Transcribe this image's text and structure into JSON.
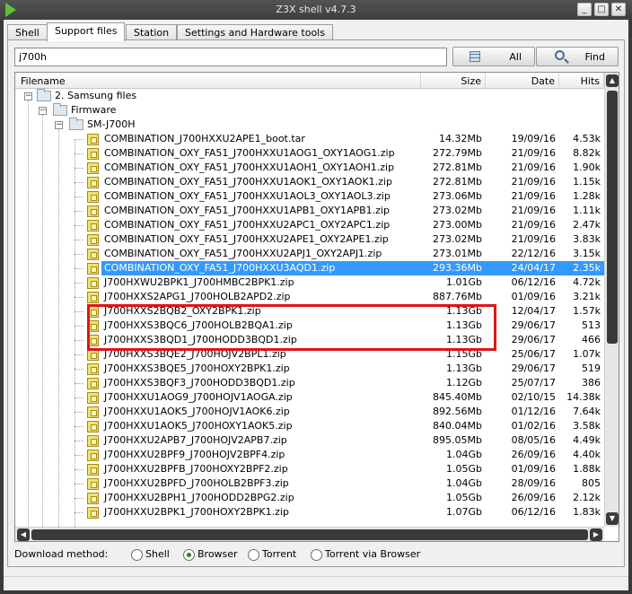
{
  "window": {
    "title": "Z3X shell v4.7.3"
  },
  "tabs": [
    {
      "label": "Shell"
    },
    {
      "label": "Support files"
    },
    {
      "label": "Station"
    },
    {
      "label": "Settings and Hardware tools"
    }
  ],
  "search": {
    "value": "j700h"
  },
  "buttons": {
    "all": "All",
    "find": "Find"
  },
  "columns": {
    "filename": "Filename",
    "size": "Size",
    "date": "Date",
    "hits": "Hits"
  },
  "tree": {
    "root": "2. Samsung files",
    "firmware": "Firmware",
    "model": "SM-J700H"
  },
  "files": [
    {
      "name": "COMBINATION_J700HXXU2APE1_boot.tar",
      "size": "14.32Mb",
      "date": "19/09/16",
      "hits": "4.53k"
    },
    {
      "name": "COMBINATION_OXY_FA51_J700HXXU1AOG1_OXY1AOG1.zip",
      "size": "272.79Mb",
      "date": "21/09/16",
      "hits": "8.82k"
    },
    {
      "name": "COMBINATION_OXY_FA51_J700HXXU1AOH1_OXY1AOH1.zip",
      "size": "272.81Mb",
      "date": "21/09/16",
      "hits": "1.90k"
    },
    {
      "name": "COMBINATION_OXY_FA51_J700HXXU1AOK1_OXY1AOK1.zip",
      "size": "272.81Mb",
      "date": "21/09/16",
      "hits": "1.15k"
    },
    {
      "name": "COMBINATION_OXY_FA51_J700HXXU1AOL3_OXY1AOL3.zip",
      "size": "273.06Mb",
      "date": "21/09/16",
      "hits": "1.28k"
    },
    {
      "name": "COMBINATION_OXY_FA51_J700HXXU1APB1_OXY1APB1.zip",
      "size": "273.02Mb",
      "date": "21/09/16",
      "hits": "1.11k"
    },
    {
      "name": "COMBINATION_OXY_FA51_J700HXXU2APC1_OXY2APC1.zip",
      "size": "273.00Mb",
      "date": "21/09/16",
      "hits": "2.47k"
    },
    {
      "name": "COMBINATION_OXY_FA51_J700HXXU2APE1_OXY2APE1.zip",
      "size": "273.02Mb",
      "date": "21/09/16",
      "hits": "3.83k"
    },
    {
      "name": "COMBINATION_OXY_FA51_J700HXXU2APJ1_OXY2APJ1.zip",
      "size": "273.01Mb",
      "date": "22/12/16",
      "hits": "3.15k"
    },
    {
      "name": "COMBINATION_OXY_FA51_J700HXXU3AQD1.zip",
      "size": "293.36Mb",
      "date": "24/04/17",
      "hits": "2.35k"
    },
    {
      "name": "J700HXWU2BPK1_J700HMBC2BPK1.zip",
      "size": "1.01Gb",
      "date": "06/12/16",
      "hits": "4.72k"
    },
    {
      "name": "J700HXXS2APG1_J700HOLB2APD2.zip",
      "size": "887.76Mb",
      "date": "01/09/16",
      "hits": "3.21k"
    },
    {
      "name": "J700HXXS2BQB2_OXY2BPK1.zip",
      "size": "1.13Gb",
      "date": "12/04/17",
      "hits": "1.57k"
    },
    {
      "name": "J700HXXS3BQC6_J700HOLB2BQA1.zip",
      "size": "1.13Gb",
      "date": "29/06/17",
      "hits": "513"
    },
    {
      "name": "J700HXXS3BQD1_J700HODD3BQD1.zip",
      "size": "1.13Gb",
      "date": "29/06/17",
      "hits": "466"
    },
    {
      "name": "J700HXXS3BQE2_J700HOJV2BPL1.zip",
      "size": "1.15Gb",
      "date": "25/06/17",
      "hits": "1.07k"
    },
    {
      "name": "J700HXXS3BQE5_J700HOXY2BPK1.zip",
      "size": "1.13Gb",
      "date": "29/06/17",
      "hits": "519"
    },
    {
      "name": "J700HXXS3BQF3_J700HODD3BQD1.zip",
      "size": "1.12Gb",
      "date": "25/07/17",
      "hits": "386"
    },
    {
      "name": "J700HXXU1AOG9_J700HOJV1AOGA.zip",
      "size": "845.40Mb",
      "date": "02/10/15",
      "hits": "14.38k"
    },
    {
      "name": "J700HXXU1AOK5_J700HOJV1AOK6.zip",
      "size": "892.56Mb",
      "date": "01/12/16",
      "hits": "7.64k"
    },
    {
      "name": "J700HXXU1AOK5_J700HOXY1AOK5.zip",
      "size": "840.04Mb",
      "date": "01/02/16",
      "hits": "3.58k"
    },
    {
      "name": "J700HXXU2APB7_J700HOJV2APB7.zip",
      "size": "895.05Mb",
      "date": "08/05/16",
      "hits": "4.49k"
    },
    {
      "name": "J700HXXU2BPF9_J700HOJV2BPF4.zip",
      "size": "1.04Gb",
      "date": "26/09/16",
      "hits": "4.40k"
    },
    {
      "name": "J700HXXU2BPFB_J700HOXY2BPF2.zip",
      "size": "1.05Gb",
      "date": "01/09/16",
      "hits": "1.88k"
    },
    {
      "name": "J700HXXU2BPFD_J700HOLB2BPF3.zip",
      "size": "1.04Gb",
      "date": "28/09/16",
      "hits": "805"
    },
    {
      "name": "J700HXXU2BPH1_J700HODD2BPG2.zip",
      "size": "1.05Gb",
      "date": "26/09/16",
      "hits": "2.12k"
    },
    {
      "name": "J700HXXU2BPK1_J700HOXY2BPK1.zip",
      "size": "1.07Gb",
      "date": "06/12/16",
      "hits": "1.83k"
    }
  ],
  "selected_index": 9,
  "download": {
    "label": "Download method:",
    "options": [
      "Shell",
      "Browser",
      "Torrent",
      "Torrent via Browser"
    ],
    "selected": "Browser"
  },
  "colors": {
    "selection": "#3399ff",
    "highlight_box": "#e0141c",
    "title_bar": "#3e3e3e"
  }
}
